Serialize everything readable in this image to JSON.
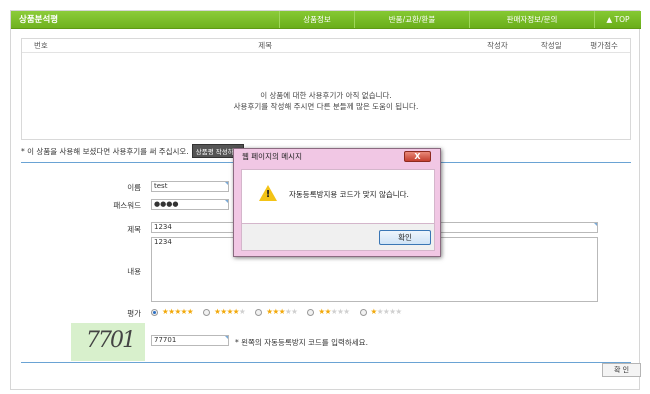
{
  "tabs": {
    "title": "상품분석평",
    "items": [
      "상품정보",
      "반품/교환/환불",
      "판매자정보/문의",
      "▲ TOP"
    ]
  },
  "review_table": {
    "headers": [
      "번호",
      "제목",
      "작성자",
      "작성일",
      "평가점수"
    ],
    "empty_line1": "이 상품에 대한 사용후기가 아직 없습니다.",
    "empty_line2": "사용후기를 작성해 주시면 다른 분들께 많은 도움이 됩니다."
  },
  "hint": {
    "text": "* 이 상품을 사용해 보셨다면 사용후기를 써 주십시오.",
    "button": "상품평 작성하기"
  },
  "form": {
    "name_label": "이름",
    "name_value": "test",
    "password_label": "패스워드",
    "password_value": "●●●●",
    "password_note": "필수",
    "title_label": "제목",
    "title_value": "1234",
    "content_label": "내용",
    "content_value": "1234",
    "rating_label": "평가",
    "rating_options": [
      5,
      4,
      3,
      2,
      1
    ],
    "rating_selected": 5,
    "captcha_text": "7701",
    "captcha_value": "77701",
    "captcha_note": "* 왼쪽의 자동등록방지 코드를 입력하세요.",
    "submit": "확 인"
  },
  "dialog": {
    "title": "웹 페이지의 메시지",
    "close": "X",
    "message": "자동등록방지용 코드가 맞지 않습니다.",
    "ok": "확인"
  }
}
